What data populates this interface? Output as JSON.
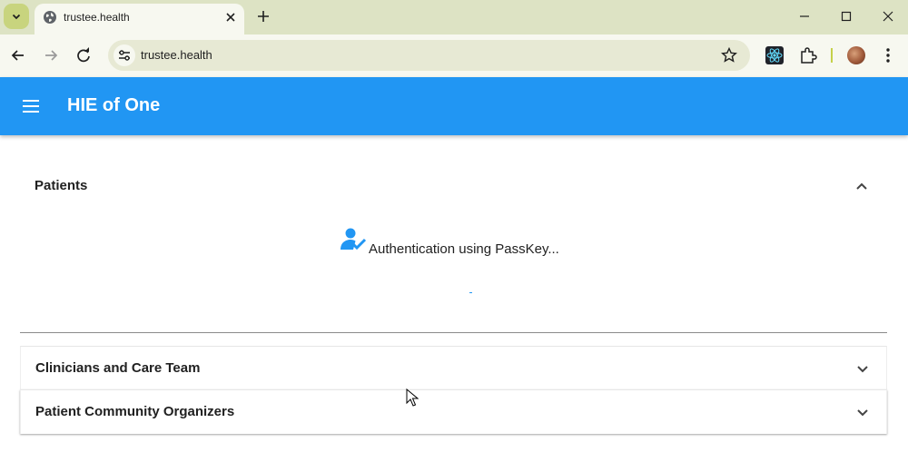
{
  "browser": {
    "tab": {
      "title": "trustee.health"
    },
    "url": "trustee.health",
    "icons": {
      "tab_search": "chevron-down-icon",
      "favicon": "globe-icon",
      "tab_close": "close-icon",
      "new_tab": "plus-icon",
      "back": "arrow-left-icon",
      "forward": "arrow-right-icon",
      "reload": "reload-icon",
      "site_info": "tune-icon",
      "bookmark": "star-outline-icon",
      "extension_react": "react-devtools-icon",
      "extensions": "puzzle-icon",
      "profile": "avatar",
      "menu": "kebab-menu-icon",
      "minimize": "minimize-icon",
      "maximize": "maximize-icon",
      "close": "close-icon"
    }
  },
  "app": {
    "title": "HIE of One",
    "menu_icon": "hamburger-menu-icon",
    "brand_color": "#2196f3"
  },
  "sections": [
    {
      "title": "Patients",
      "expanded": true,
      "icon": "chevron-up-icon",
      "status": {
        "icon": "person-check-icon",
        "text": "Authentication using PassKey..."
      }
    },
    {
      "title": "Clinicians and Care Team",
      "expanded": false,
      "icon": "chevron-down-icon"
    },
    {
      "title": "Patient Community Organizers",
      "expanded": false,
      "icon": "chevron-down-icon"
    }
  ]
}
